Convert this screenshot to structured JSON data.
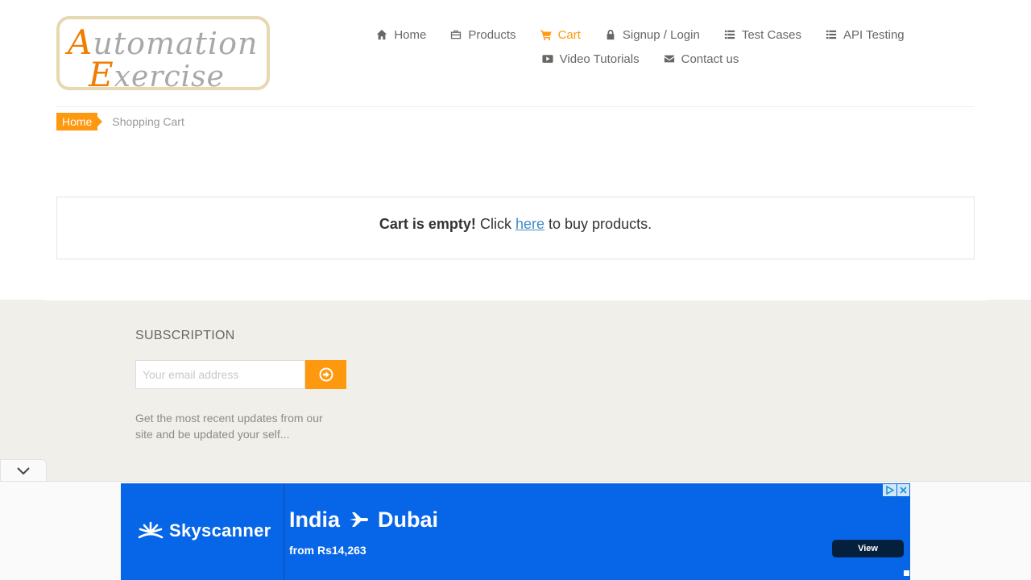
{
  "logo": {
    "line1_first": "A",
    "line1_rest": "utomation",
    "line2_first": "E",
    "line2_rest": "xercise"
  },
  "nav": [
    {
      "label": "Home",
      "icon": "home-icon"
    },
    {
      "label": "Products",
      "icon": "products-icon"
    },
    {
      "label": "Cart",
      "icon": "cart-icon",
      "active": true
    },
    {
      "label": "Signup / Login",
      "icon": "lock-icon"
    },
    {
      "label": "Test Cases",
      "icon": "list-icon"
    },
    {
      "label": "API Testing",
      "icon": "list-icon"
    },
    {
      "label": "Video Tutorials",
      "icon": "youtube-play-icon"
    },
    {
      "label": "Contact us",
      "icon": "envelope-icon"
    }
  ],
  "breadcrumb": {
    "home": "Home",
    "current": "Shopping Cart"
  },
  "cart": {
    "empty_bold": "Cart is empty!",
    "click": "Click",
    "link": "here",
    "tail": "to buy products."
  },
  "subscription": {
    "title": "SUBSCRIPTION",
    "placeholder": "Your email address",
    "note": "Get the most recent updates from our site and be updated your self..."
  },
  "ad": {
    "brand": "Skyscanner",
    "headline_from": "India",
    "headline_to": "Dubai",
    "price": "from Rs14,263",
    "button": "View"
  },
  "colors": {
    "accent": "#fe980f",
    "link": "#428bca",
    "footer_bg": "#f0efe9",
    "ad_bg": "#0766e7"
  }
}
